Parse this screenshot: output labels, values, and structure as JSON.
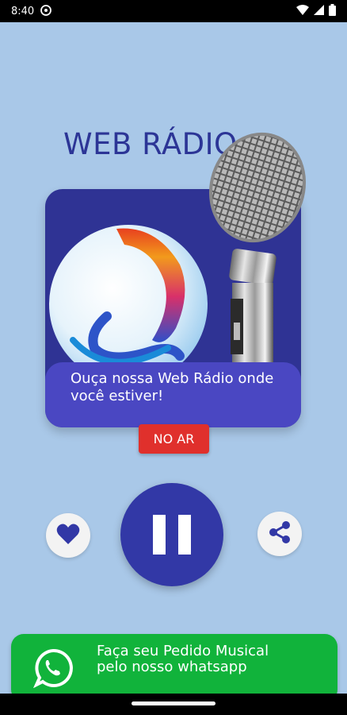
{
  "status_bar": {
    "time": "8:40",
    "icons": [
      "shield-settings-icon",
      "wifi-icon",
      "signal-icon",
      "battery-icon"
    ]
  },
  "header": {
    "title": "WEB RÁDIO"
  },
  "card": {
    "caption": "Ouça nossa Web Rádio onde você estiver!"
  },
  "live_badge": "NO AR",
  "player": {
    "state": "playing",
    "favorite_icon": "heart-icon",
    "main_icon": "pause-icon",
    "share_icon": "share-icon"
  },
  "whatsapp_banner": {
    "text": "Faça seu Pedido Musical pelo nosso whatsapp",
    "icon": "whatsapp-icon"
  },
  "colors": {
    "background": "#a9c8e8",
    "primary": "#3238a6",
    "live": "#e0302c",
    "whatsapp": "#11b33b"
  }
}
